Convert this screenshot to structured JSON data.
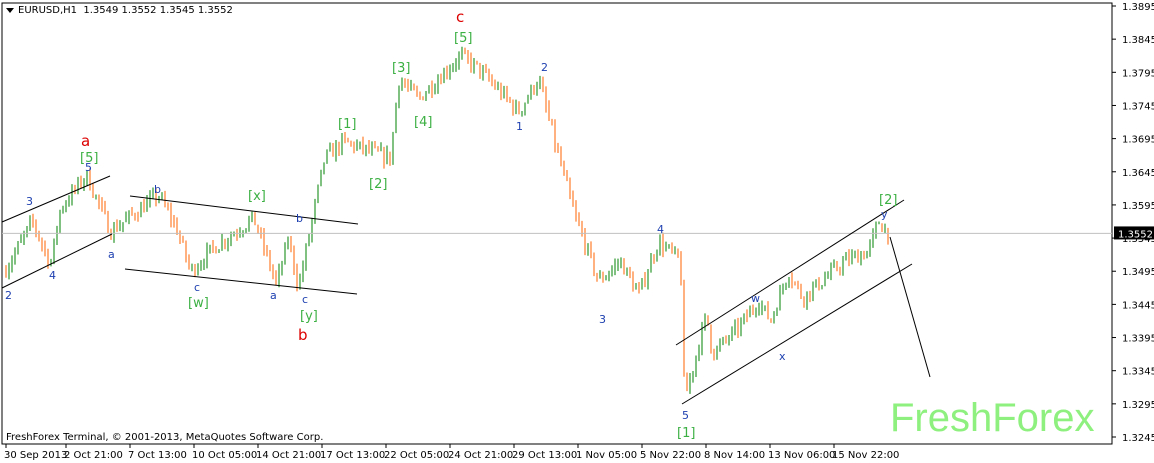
{
  "header": {
    "symbol": "EURUSD,H1",
    "ohlc": "1.3549 1.3552 1.3545 1.3552"
  },
  "footer": {
    "copyright": "FreshForex Terminal, © 2001-2013, MetaQuotes Software Corp."
  },
  "watermark": "FreshForex",
  "colors": {
    "background": "#ffffff",
    "frame": "#000000",
    "candle_up": "#008000",
    "candle_down": "#ff6600",
    "bid_line": "#c0c0c0",
    "price_tag": "#000000",
    "wave_blue": "#1e40b0",
    "wave_green": "#3cb043",
    "wave_red": "#dd0000",
    "watermark": "#8ef07e"
  },
  "chart_data": {
    "type": "candlestick",
    "timeframe": "H1",
    "current_price": 1.3552,
    "ylim": [
      1.3245,
      1.3895
    ],
    "yticks": [
      "1.3895",
      "1.3845",
      "1.3795",
      "1.3745",
      "1.3695",
      "1.3645",
      "1.3595",
      "1.3545",
      "1.3495",
      "1.3445",
      "1.3395",
      "1.3345",
      "1.3295",
      "1.3245"
    ],
    "xticks": [
      "30 Sep 2013",
      "2 Oct 21:00",
      "7 Oct 13:00",
      "10 Oct 05:00",
      "14 Oct 21:00",
      "17 Oct 13:00",
      "22 Oct 05:00",
      "24 Oct 21:00",
      "29 Oct 13:00",
      "1 Nov 05:00",
      "5 Nov 22:00",
      "8 Nov 14:00",
      "13 Nov 06:00",
      "15 Nov 22:00"
    ],
    "price_path": [
      {
        "t": "30 Sep 2013",
        "price": 1.3495
      },
      {
        "t": "1 Oct",
        "price": 1.357
      },
      {
        "t": "2 Oct",
        "price": 1.3505
      },
      {
        "t": "2 Oct 21:00",
        "price": 1.359
      },
      {
        "t": "3 Oct",
        "price": 1.364
      },
      {
        "t": "4 Oct",
        "price": 1.3555
      },
      {
        "t": "7 Oct 13:00",
        "price": 1.361
      },
      {
        "t": "8 Oct",
        "price": 1.356
      },
      {
        "t": "9 Oct",
        "price": 1.3495
      },
      {
        "t": "10 Oct 05:00",
        "price": 1.353
      },
      {
        "t": "11 Oct",
        "price": 1.3575
      },
      {
        "t": "14 Oct",
        "price": 1.3475
      },
      {
        "t": "14 Oct 21:00",
        "price": 1.3545
      },
      {
        "t": "15 Oct",
        "price": 1.347
      },
      {
        "t": "16 Oct",
        "price": 1.356
      },
      {
        "t": "17 Oct 13:00",
        "price": 1.3665
      },
      {
        "t": "18 Oct",
        "price": 1.369
      },
      {
        "t": "21 Oct",
        "price": 1.3665
      },
      {
        "t": "22 Oct 05:00",
        "price": 1.3785
      },
      {
        "t": "23 Oct",
        "price": 1.3755
      },
      {
        "t": "24 Oct 21:00",
        "price": 1.382
      },
      {
        "t": "25 Oct",
        "price": 1.38
      },
      {
        "t": "28 Oct",
        "price": 1.376
      },
      {
        "t": "29 Oct 13:00",
        "price": 1.3735
      },
      {
        "t": "29 Oct 18:00",
        "price": 1.3785
      },
      {
        "t": "30 Oct",
        "price": 1.369
      },
      {
        "t": "31 Oct",
        "price": 1.358
      },
      {
        "t": "1 Nov 05:00",
        "price": 1.348
      },
      {
        "t": "4 Nov",
        "price": 1.351
      },
      {
        "t": "4 Nov 12:00",
        "price": 1.346
      },
      {
        "t": "5 Nov",
        "price": 1.354
      },
      {
        "t": "5 Nov 22:00",
        "price": 1.351
      },
      {
        "t": "7 Nov",
        "price": 1.33
      },
      {
        "t": "7 Nov 12:00",
        "price": 1.343
      },
      {
        "t": "8 Nov 14:00",
        "price": 1.337
      },
      {
        "t": "11 Nov",
        "price": 1.341
      },
      {
        "t": "12 Nov",
        "price": 1.345
      },
      {
        "t": "13 Nov 06:00",
        "price": 1.342
      },
      {
        "t": "14 Nov",
        "price": 1.3495
      },
      {
        "t": "15 Nov",
        "price": 1.3455
      },
      {
        "t": "15 Nov 22:00",
        "price": 1.351
      },
      {
        "t": "18 Nov",
        "price": 1.3525
      },
      {
        "t": "18 Nov 12:00",
        "price": 1.357
      },
      {
        "t": "19 Nov",
        "price": 1.3552
      }
    ],
    "wave_labels": [
      {
        "text": "2",
        "color": "blue"
      },
      {
        "text": "3",
        "color": "blue"
      },
      {
        "text": "4",
        "color": "blue"
      },
      {
        "text": "5",
        "color": "blue"
      },
      {
        "text": "[5]",
        "color": "green"
      },
      {
        "text": "a",
        "color": "red"
      },
      {
        "text": "a",
        "color": "blue"
      },
      {
        "text": "b",
        "color": "blue"
      },
      {
        "text": "c",
        "color": "blue"
      },
      {
        "text": "[w]",
        "color": "green"
      },
      {
        "text": "[x]",
        "color": "green"
      },
      {
        "text": "a",
        "color": "blue"
      },
      {
        "text": "b",
        "color": "blue"
      },
      {
        "text": "c",
        "color": "blue"
      },
      {
        "text": "[y]",
        "color": "green"
      },
      {
        "text": "b",
        "color": "red"
      },
      {
        "text": "[1]",
        "color": "green"
      },
      {
        "text": "[2]",
        "color": "green"
      },
      {
        "text": "[3]",
        "color": "green"
      },
      {
        "text": "[4]",
        "color": "green"
      },
      {
        "text": "[5]",
        "color": "green"
      },
      {
        "text": "c",
        "color": "red"
      },
      {
        "text": "1",
        "color": "blue"
      },
      {
        "text": "2",
        "color": "blue"
      },
      {
        "text": "3",
        "color": "blue"
      },
      {
        "text": "4",
        "color": "blue"
      },
      {
        "text": "5",
        "color": "blue"
      },
      {
        "text": "[1]",
        "color": "green"
      },
      {
        "text": "w",
        "color": "blue"
      },
      {
        "text": "x",
        "color": "blue"
      },
      {
        "text": "y",
        "color": "blue"
      },
      {
        "text": "[2]",
        "color": "green"
      }
    ]
  }
}
